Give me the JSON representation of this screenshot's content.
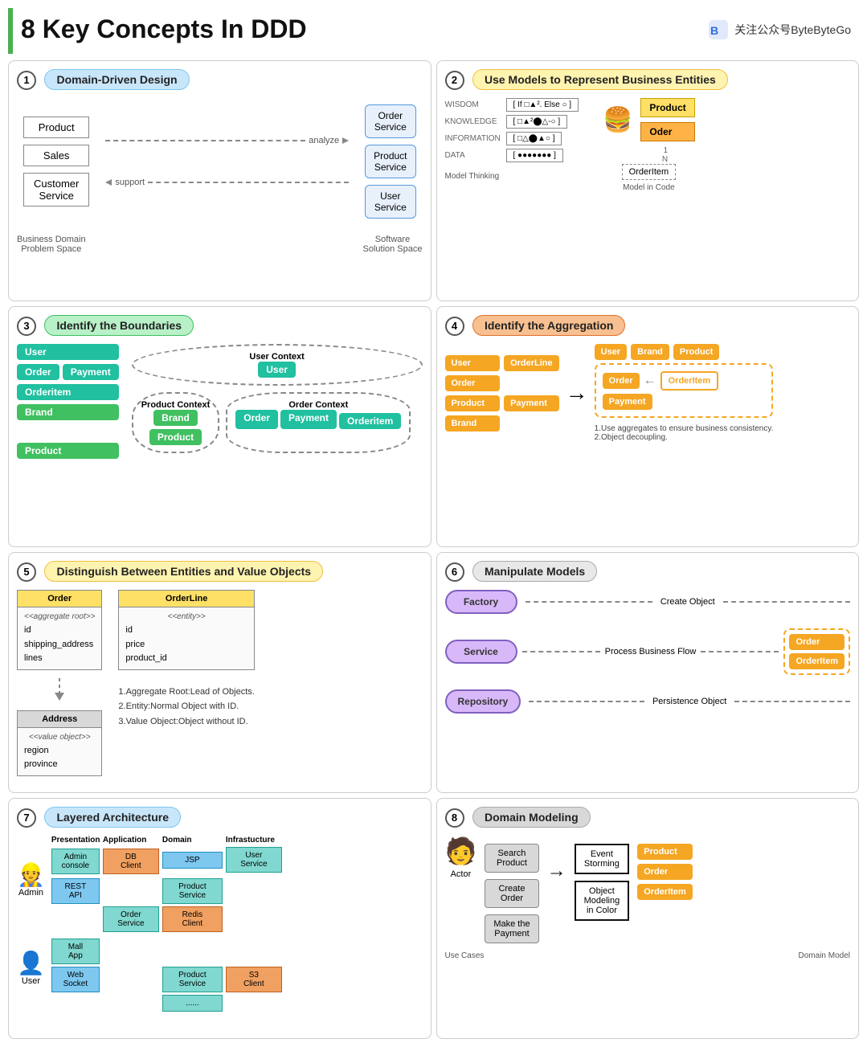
{
  "header": {
    "title": "8 Key Concepts In DDD",
    "brand": "关注公众号ByteByteGo"
  },
  "sections": [
    {
      "num": "1",
      "title": "Domain-Driven Design",
      "title_style": "s1-title"
    },
    {
      "num": "2",
      "title": "Use Models to Represent Business Entities",
      "title_style": "s2-title"
    },
    {
      "num": "3",
      "title": "Identify the Boundaries",
      "title_style": "s3-title"
    },
    {
      "num": "4",
      "title": "Identify the Aggregation",
      "title_style": "s4-title"
    },
    {
      "num": "5",
      "title": "Distinguish Between Entities and Value Objects",
      "title_style": "s5-title"
    },
    {
      "num": "6",
      "title": "Manipulate Models",
      "title_style": "s6-title"
    },
    {
      "num": "7",
      "title": "Layered Architecture",
      "title_style": "s7-title"
    },
    {
      "num": "8",
      "title": "Domain Modeling",
      "title_style": "s8-title"
    }
  ],
  "s1": {
    "left_boxes": [
      "Product",
      "Sales",
      "Customer Service"
    ],
    "right_boxes": [
      "Order Service",
      "Product Service",
      "User Service"
    ],
    "arrow_top": "analyze",
    "arrow_bottom": "support",
    "label_left": "Business Domain Problem Space",
    "label_right": "Software Solution Space"
  },
  "s2": {
    "layers": [
      "WISDOM",
      "KNOWLEDGE",
      "INFORMATION",
      "DATA"
    ],
    "labels_left": "Model Thinking",
    "labels_right": "Model in Code",
    "right_items": [
      "Product",
      "Oder",
      "OrderItem"
    ]
  },
  "s3": {
    "entities": [
      "User",
      "Order",
      "Payment",
      "Orderitem",
      "Brand",
      "Product"
    ],
    "contexts": [
      {
        "name": "User Context",
        "items": [
          "User"
        ]
      },
      {
        "name": "Product Context",
        "items": [
          "Brand",
          "Product"
        ]
      },
      {
        "name": "Order Context",
        "items": [
          "Order",
          "Payment",
          "Orderitem"
        ]
      }
    ]
  },
  "s4": {
    "before": [
      "User",
      "Order",
      "Product",
      "Brand",
      "OrderLine",
      "Payment"
    ],
    "after_top": [
      "User",
      "Brand",
      "Product"
    ],
    "after_box": [
      "Order"
    ],
    "after_connected": [
      "OrderItem",
      "Payment"
    ],
    "notes": [
      "1.Use aggregates to ensure business consistency.",
      "2.Object decoupling."
    ]
  },
  "s5": {
    "order_class": {
      "name": "Order",
      "stereotype": "<<aggregate root>>",
      "fields": [
        "id",
        "shipping_address",
        "lines"
      ]
    },
    "orderline_class": {
      "name": "OrderLine",
      "stereotype": "<<entity>>",
      "fields": [
        "id",
        "price",
        "product_id"
      ]
    },
    "address_class": {
      "name": "Address",
      "stereotype": "<<value object>>",
      "fields": [
        "region",
        "province"
      ]
    },
    "notes": [
      "1.Aggregate Root:Lead of Objects.",
      "2.Entity:Normal Object with ID.",
      "3.Value Object:Object without ID."
    ]
  },
  "s6": {
    "actors": [
      "Factory",
      "Service",
      "Repository"
    ],
    "labels": [
      "Create Object",
      "Process Business Flow",
      "Persistence Object"
    ],
    "target_box": [
      "Order",
      "OrderItem"
    ]
  },
  "s7": {
    "cols": [
      "Presentation",
      "Application",
      "Domain",
      "Infrastucture"
    ],
    "actors": [
      "Admin",
      "User"
    ],
    "pres_boxes": [
      "JSP",
      "REST API",
      "Web Socket"
    ],
    "app_boxes": [
      "Admin console",
      "Mall App"
    ],
    "domain_boxes": [
      "User Service",
      "Product Service",
      "Order Service",
      "Product Service",
      "......"
    ],
    "infra_boxes": [
      "DB Client",
      "Redis Client",
      "S3 Client"
    ]
  },
  "s8": {
    "use_cases": [
      "Search Product",
      "Create Order",
      "Make the Payment"
    ],
    "actor_label": "Actor",
    "actor_label2": "Use Cases",
    "center_labels": [
      "Event Storming",
      "Object Modeling in Color"
    ],
    "domain_label": "Domain Model",
    "domain_items": [
      "Product",
      "Order",
      "OrderItem"
    ]
  }
}
